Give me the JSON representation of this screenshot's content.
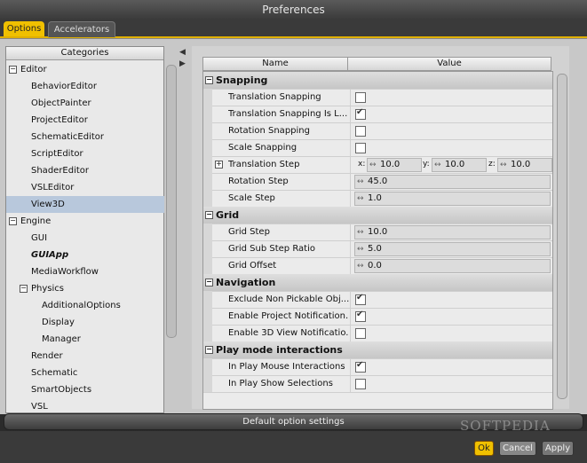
{
  "window": {
    "title": "Preferences"
  },
  "tabs": [
    {
      "label": "Options"
    },
    {
      "label": "Accelerators"
    }
  ],
  "categories": {
    "header": "Categories",
    "items": [
      {
        "label": "Editor"
      },
      {
        "label": "BehaviorEditor"
      },
      {
        "label": "ObjectPainter"
      },
      {
        "label": "ProjectEditor"
      },
      {
        "label": "SchematicEditor"
      },
      {
        "label": "ScriptEditor"
      },
      {
        "label": "ShaderEditor"
      },
      {
        "label": "VSLEditor"
      },
      {
        "label": "View3D"
      },
      {
        "label": "Engine"
      },
      {
        "label": "GUI"
      },
      {
        "label": "GUIApp"
      },
      {
        "label": "MediaWorkflow"
      },
      {
        "label": "Physics"
      },
      {
        "label": "AdditionalOptions"
      },
      {
        "label": "Display"
      },
      {
        "label": "Manager"
      },
      {
        "label": "Render"
      },
      {
        "label": "Schematic"
      },
      {
        "label": "SmartObjects"
      },
      {
        "label": "VSL"
      }
    ]
  },
  "properties": {
    "col_name": "Name",
    "col_value": "Value",
    "sections": {
      "snapping": "Snapping",
      "grid": "Grid",
      "navigation": "Navigation",
      "playmode": "Play mode interactions"
    },
    "rows": {
      "translation_snapping": {
        "name": "Translation Snapping",
        "checked": false
      },
      "translation_snapping_local": {
        "name": "Translation Snapping Is L...",
        "checked": true
      },
      "rotation_snapping": {
        "name": "Rotation Snapping",
        "checked": false
      },
      "scale_snapping": {
        "name": "Scale Snapping",
        "checked": false
      },
      "translation_step": {
        "name": "Translation Step",
        "x_label": "x:",
        "x": "10.0",
        "y_label": "y:",
        "y": "10.0",
        "z_label": "z:",
        "z": "10.0"
      },
      "rotation_step": {
        "name": "Rotation Step",
        "value": "45.0"
      },
      "scale_step": {
        "name": "Scale Step",
        "value": "1.0"
      },
      "grid_step": {
        "name": "Grid Step",
        "value": "10.0"
      },
      "grid_sub_step_ratio": {
        "name": "Grid Sub Step Ratio",
        "value": "5.0"
      },
      "grid_offset": {
        "name": "Grid Offset",
        "value": "0.0"
      },
      "exclude_non_pickable": {
        "name": "Exclude Non Pickable Obj...",
        "checked": true
      },
      "enable_project_notification": {
        "name": "Enable Project Notification...",
        "checked": true
      },
      "enable_3d_view_notification": {
        "name": "Enable 3D View Notificatio...",
        "checked": false
      },
      "in_play_mouse_interactions": {
        "name": "In Play Mouse Interactions",
        "checked": true
      },
      "in_play_show_selections": {
        "name": "In Play Show Selections",
        "checked": false
      }
    }
  },
  "footer": {
    "default_settings": "Default option settings",
    "ok": "Ok",
    "cancel": "Cancel",
    "apply": "Apply",
    "watermark": "SOFTPEDIA"
  }
}
